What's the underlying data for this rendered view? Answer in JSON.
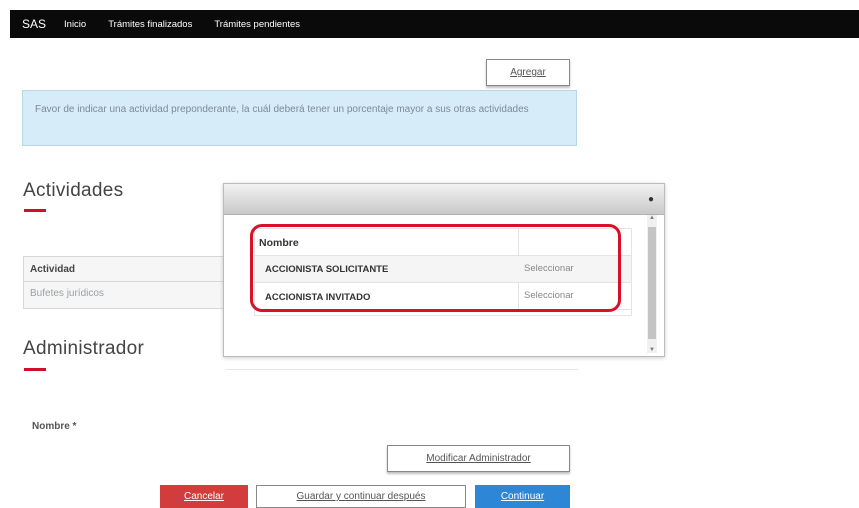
{
  "topbar": {
    "brand": "SAS",
    "nav": [
      "Inicio",
      "Trámites finalizados",
      "Trámites pendientes"
    ]
  },
  "agregar_label": "Agregar",
  "alert_text": "Favor de indicar una actividad preponderante, la cuál deberá tener un porcentaje mayor a sus otras actividades",
  "actividades": {
    "title": "Actividades",
    "col_header": "Actividad",
    "row_value": "Bufetes jurídicos"
  },
  "administrador": {
    "title": "Administrador",
    "nombre_label": "Nombre *",
    "modificar_label": "Modificar Administrador"
  },
  "modal": {
    "header": "Nombre",
    "rows": [
      {
        "name": "ACCIONISTA SOLICITANTE",
        "action": "Seleccionar"
      },
      {
        "name": "ACCIONISTA INVITADO",
        "action": "Seleccionar"
      }
    ]
  },
  "footer": {
    "cancel": "Cancelar",
    "save_later": "Guardar y continuar después",
    "continue": "Continuar"
  },
  "colors": {
    "topbar": "#0a0a0a",
    "accent_red": "#d0102a",
    "cancel_red": "#d33c3c",
    "continue_blue": "#2e86d6",
    "alert_bg": "#d6ecf8"
  }
}
